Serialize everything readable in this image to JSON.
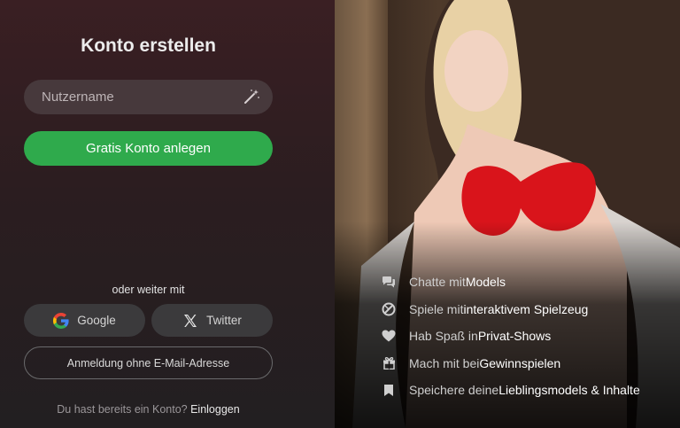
{
  "signup": {
    "title": "Konto erstellen",
    "username_placeholder": "Nutzername",
    "create_button": "Gratis Konto anlegen",
    "or_continue": "oder weiter mit",
    "google_label": "Google",
    "twitter_label": "Twitter",
    "no_email_button": "Anmeldung ohne E-Mail-Adresse",
    "have_account": "Du hast bereits ein Konto?",
    "login_link": "Einloggen"
  },
  "features": [
    {
      "icon": "chat-bubbles-icon",
      "prefix": "Chatte mit ",
      "highlight": "Models",
      "suffix": ""
    },
    {
      "icon": "toy-icon",
      "prefix": "Spiele mit ",
      "highlight": "interaktivem Spielzeug",
      "suffix": ""
    },
    {
      "icon": "heart-icon",
      "prefix": "Hab Spaß in ",
      "highlight": "Privat-Shows",
      "suffix": ""
    },
    {
      "icon": "gift-icon",
      "prefix": "Mach mit bei ",
      "highlight": "Gewinnspielen",
      "suffix": ""
    },
    {
      "icon": "bookmark-icon",
      "prefix": "Speichere deine ",
      "highlight": "Lieblingsmodels & Inhalte",
      "suffix": ""
    }
  ],
  "colors": {
    "primary_green": "#2faa4c",
    "left_panel_top": "#3a1f23",
    "input_bg": "#47393c",
    "social_bg": "#3b3a3c"
  }
}
